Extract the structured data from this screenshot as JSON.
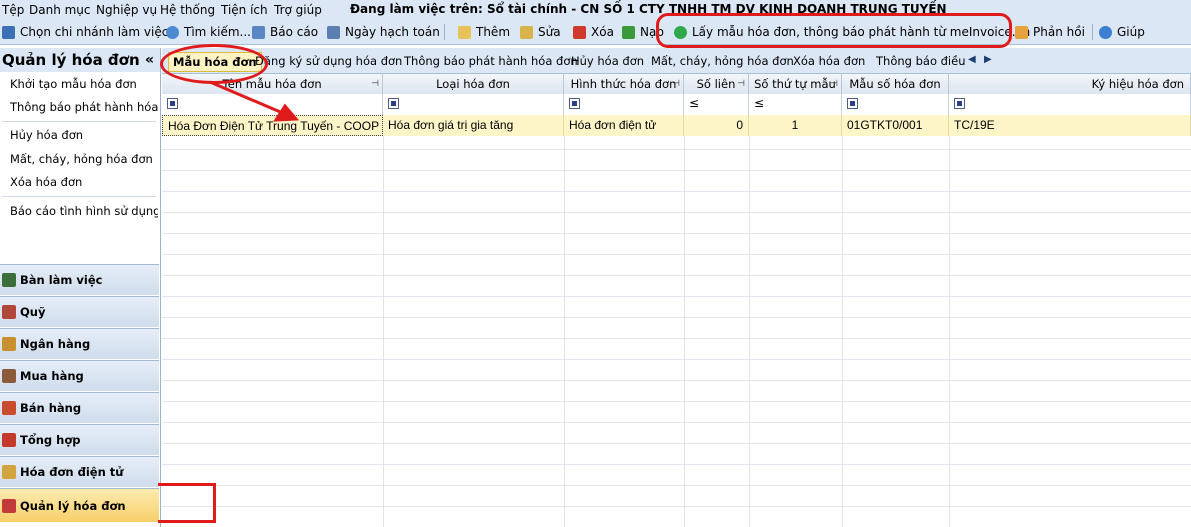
{
  "menu": [
    "Tệp",
    "Danh mục",
    "Nghiệp vụ",
    "Hệ thống",
    "Tiện ích",
    "Trợ giúp"
  ],
  "workspace_title": "Đang làm việc trên: Sổ tài chính - CN SỐ 1 CTY TNHH TM DV KINH DOANH TRUNG TUYẾN",
  "toolbar": {
    "choose_branch": "Chọn chi nhánh làm việc",
    "search": "Tìm kiếm...",
    "report": "Báo cáo",
    "posting_date": "Ngày hạch toán",
    "add": "Thêm",
    "edit": "Sửa",
    "delete": "Xóa",
    "load": "Nạp",
    "fetch_template": "Lấy mẫu hóa đơn, thông báo phát hành từ meInvoice.vn",
    "feedback": "Phản hồi",
    "help": "Giúp"
  },
  "left_panel": {
    "title": "Quản lý hóa đơn",
    "collapse": "«",
    "items": [
      "Khởi tạo mẫu hóa đơn",
      "Thông báo phát hành hóa đ...",
      "Hủy hóa đơn",
      "Mất, cháy, hỏng hóa đơn",
      "Xóa hóa đơn",
      "Báo cáo tình hình sử dụng..."
    ]
  },
  "modules": [
    "Bàn làm việc",
    "Quỹ",
    "Ngân hàng",
    "Mua hàng",
    "Bán hàng",
    "Tổng hợp",
    "Hóa đơn điện tử",
    "Quản lý hóa đơn"
  ],
  "tabs": [
    "Mẫu hóa đơn",
    "Đăng ký sử dụng hóa đơn",
    "Thông báo phát hành hóa đơn",
    "Hủy hóa đơn",
    "Mất, cháy, hỏng hóa đơn",
    "Xóa hóa đơn",
    "Thông báo điều ch"
  ],
  "table": {
    "columns": [
      "Tên mẫu hóa đơn",
      "Loại hóa đơn",
      "Hình thức hóa đơn",
      "Số liên",
      "Số thứ tự mẫu",
      "Mẫu số hóa đơn",
      "Ký hiệu hóa đơn"
    ],
    "filter_ops": [
      "",
      "",
      "",
      "≤",
      "≤",
      "",
      ""
    ],
    "rows": [
      [
        "Hóa Đơn Điện Tử Trung Tuyến - COOP",
        "Hóa đơn giá trị gia tăng",
        "Hóa đơn điện tử",
        "0",
        "1",
        "01GTKT0/001",
        "TC/19E"
      ]
    ]
  },
  "colors": {
    "highlight_red": "#e01b1b",
    "toolbar_bg": "#dbe7f5",
    "selected_row": "#fdf4c8"
  }
}
